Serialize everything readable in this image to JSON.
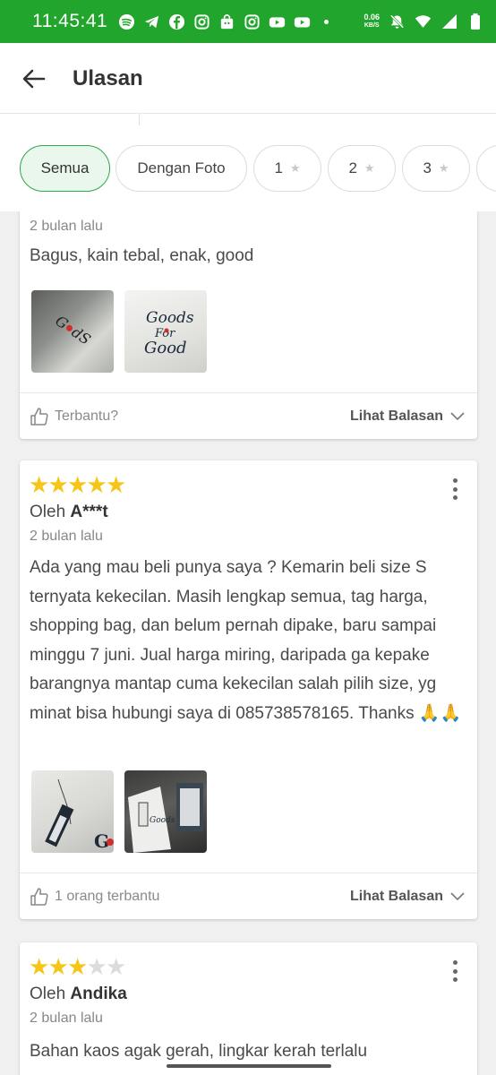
{
  "status_bar": {
    "time": "11:45:41",
    "net_speed_value": "0.06",
    "net_speed_unit": "KB/S",
    "icons": [
      "spotify-icon",
      "telegram-icon",
      "facebook-icon",
      "instagram-icon",
      "shopping-bag-icon",
      "instagram-icon",
      "youtube-icon",
      "youtube-icon",
      "mute-icon",
      "wifi-icon",
      "signal-icon",
      "battery-icon"
    ]
  },
  "header": {
    "title": "Ulasan"
  },
  "filters": {
    "chips": [
      {
        "label": "Semua",
        "active": true
      },
      {
        "label": "Dengan Foto",
        "active": false
      },
      {
        "label": "1",
        "active": false
      },
      {
        "label": "2",
        "active": false
      },
      {
        "label": "3",
        "active": false
      }
    ]
  },
  "reviews": [
    {
      "time": "2 bulan lalu",
      "text": "Bagus, kain tebal, enak, good",
      "helpful": "Terbantu?",
      "replies": "Lihat Balasan"
    },
    {
      "rating": 5,
      "by_prefix": "Oleh",
      "author": "A***t",
      "time": "2 bulan lalu",
      "text": "Ada yang mau beli punya saya ? Kemarin beli size S ternyata kekecilan. Masih lengkap semua, tag harga, shopping bag, dan belum pernah dipake, baru sampai minggu 7 juni. Jual harga miring, daripada ga kepake barangnya mantap cuma kekecilan salah pilih size, yg minat bisa hubungi saya di 085738578165. Thanks 🙏🙏",
      "helpful": "1 orang terbantu",
      "replies": "Lihat Balasan"
    },
    {
      "rating": 3,
      "by_prefix": "Oleh",
      "author": "Andika",
      "time": "2 bulan lalu",
      "text": "Bahan kaos agak gerah, lingkar kerah terlalu"
    }
  ],
  "colors": {
    "brand_green": "#22a52c",
    "star_yellow": "#f5c518"
  }
}
